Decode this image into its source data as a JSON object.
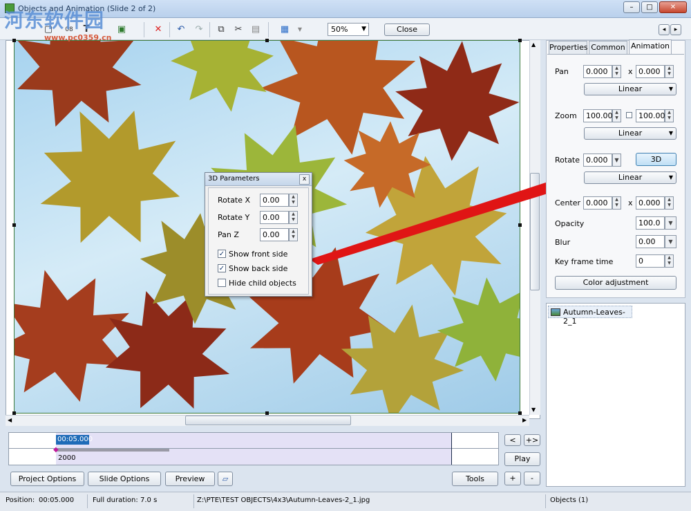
{
  "window": {
    "title": "Objects and Animation  (Slide 2 of 2)"
  },
  "watermark": {
    "main": "河东软件园",
    "url": "www.pc0359.cn"
  },
  "toolbar": {
    "zoom": "50%",
    "close_label": "Close",
    "nav_prev": "◂",
    "nav_next": "▸"
  },
  "dialog_3d": {
    "title": "3D Parameters",
    "close": "x",
    "rotate_x_label": "Rotate X",
    "rotate_x": "0.00",
    "rotate_y_label": "Rotate Y",
    "rotate_y": "0.00",
    "pan_z_label": "Pan Z",
    "pan_z": "0.00",
    "show_front_label": "Show front side",
    "show_front": true,
    "show_back_label": "Show back side",
    "show_back": true,
    "hide_child_label": "Hide child objects",
    "hide_child": false
  },
  "tabs": [
    "Properties",
    "Common",
    "Animation"
  ],
  "animation": {
    "pan_label": "Pan",
    "pan_x": "0.000",
    "pan_y": "0.000",
    "x": "x",
    "pan_mode": "Linear",
    "zoom_label": "Zoom",
    "zoom_x": "100.000",
    "zoom_y": "100.000",
    "zoom_mode": "Linear",
    "rotate_label": "Rotate",
    "rotate": "0.000",
    "btn_3d": "3D",
    "rotate_mode": "Linear",
    "center_label": "Center",
    "center_x": "0.000",
    "center_y": "0.000",
    "opacity_label": "Opacity",
    "opacity": "100.0",
    "blur_label": "Blur",
    "blur": "0.00",
    "keyframe_label": "Key frame time",
    "keyframe": "0",
    "color_adjust": "Color adjustment"
  },
  "objects": {
    "item": "Autumn-Leaves-2_1"
  },
  "timeline": {
    "time": "00:05.000",
    "duration_ms": "2000",
    "btn_lt": "<",
    "btn_gtplus": "+>",
    "play": "Play",
    "plus": "+",
    "minus": "-"
  },
  "bottom": {
    "project_options": "Project Options",
    "slide_options": "Slide Options",
    "preview": "Preview",
    "tools": "Tools"
  },
  "status": {
    "position_label": "Position:",
    "position": "00:05.000",
    "duration_label": "Full duration:",
    "duration": "7.0 s",
    "path": "Z:\\PTE\\TEST OBJECTS\\4x3\\Autumn-Leaves-2_1.jpg",
    "objects": "Objects (1)"
  }
}
